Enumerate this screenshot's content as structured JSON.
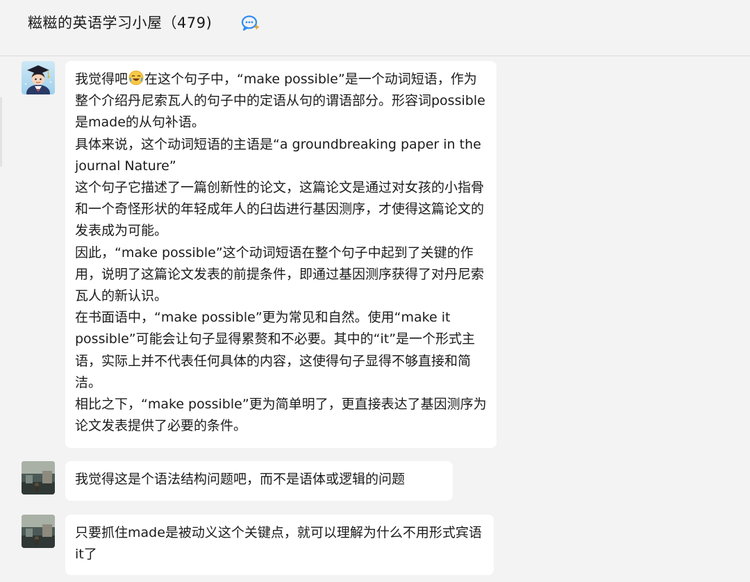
{
  "header": {
    "title": "糍糍的英语学习小屋（479)",
    "icon": "chat-bubble-icon"
  },
  "messages": [
    {
      "avatar": "graduate-avatar",
      "lines": [
        "我觉得吧",
        "在这个句子中，“make possible”是一个动词短语，作为整个介绍丹尼索瓦人的句子中的定语从句的谓语部分。形容词possible是made的从句补语。",
        "具体来说，这个动词短语的主语是“a groundbreaking paper in the journal Nature”",
        "这个句子它描述了一篇创新性的论文，这篇论文是通过对女孩的小指骨和一个奇怪形状的年轻成年人的臼齿进行基因测序，才使得这篇论文的发表成为可能。",
        "因此，“make possible”这个动词短语在整个句子中起到了关键的作用，说明了这篇论文发表的前提条件，即通过基因测序获得了对丹尼索瓦人的新认识。",
        "在书面语中，“make possible”更为常见和自然。使用“make it possible”可能会让句子显得累赘和不必要。其中的“it”是一个形式主语，实际上并不代表任何具体的内容，这使得句子显得不够直接和简洁。",
        "相比之下，“make possible”更为简单明了，更直接表达了基因测序为论文发表提供了必要的条件。"
      ],
      "emoji": "laughing-crying-emoji"
    },
    {
      "avatar": "scenery-avatar",
      "text": "我觉得这是个语法结构问题吧，而不是语体或逻辑的问题"
    },
    {
      "avatar": "scenery-avatar",
      "text": "只要抓住made是被动义这个关键点，就可以理解为什么不用形式宾语it了"
    }
  ]
}
